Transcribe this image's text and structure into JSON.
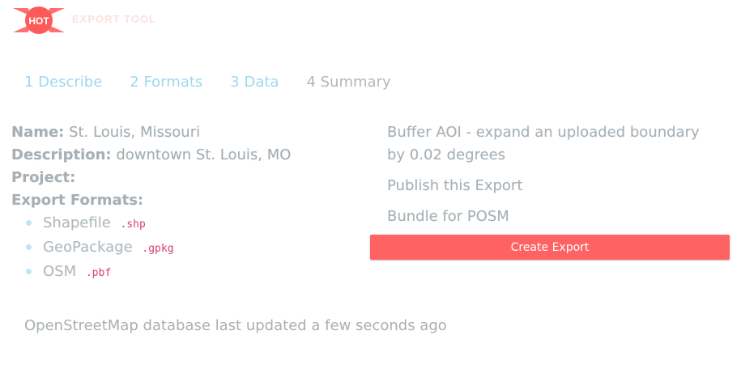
{
  "header": {
    "logo_text": "HOT",
    "brand": "EXPORT TOOL"
  },
  "steps": [
    {
      "label": "1 Describe"
    },
    {
      "label": "2 Formats"
    },
    {
      "label": "3 Data"
    },
    {
      "label": "4 Summary"
    }
  ],
  "summary": {
    "name_label": "Name:",
    "name_value": "St. Louis, Missouri",
    "description_label": "Description:",
    "description_value": "downtown St. Louis, MO",
    "project_label": "Project:",
    "formats_label": "Export Formats:",
    "formats": [
      {
        "name": "Shapefile",
        "ext": ".shp"
      },
      {
        "name": "GeoPackage",
        "ext": ".gpkg"
      },
      {
        "name": "OSM",
        "ext": ".pbf"
      }
    ]
  },
  "options": {
    "buffer": "Buffer AOI - expand an uploaded boundary by 0.02 degrees",
    "publish": "Publish this Export",
    "bundle": "Bundle for POSM"
  },
  "create_button": "Create Export",
  "footer": "OpenStreetMap database last updated a few seconds ago",
  "colors": {
    "accent": "#ff6262",
    "step_link": "#9fd8ee",
    "ext_code": "#e0457b"
  }
}
